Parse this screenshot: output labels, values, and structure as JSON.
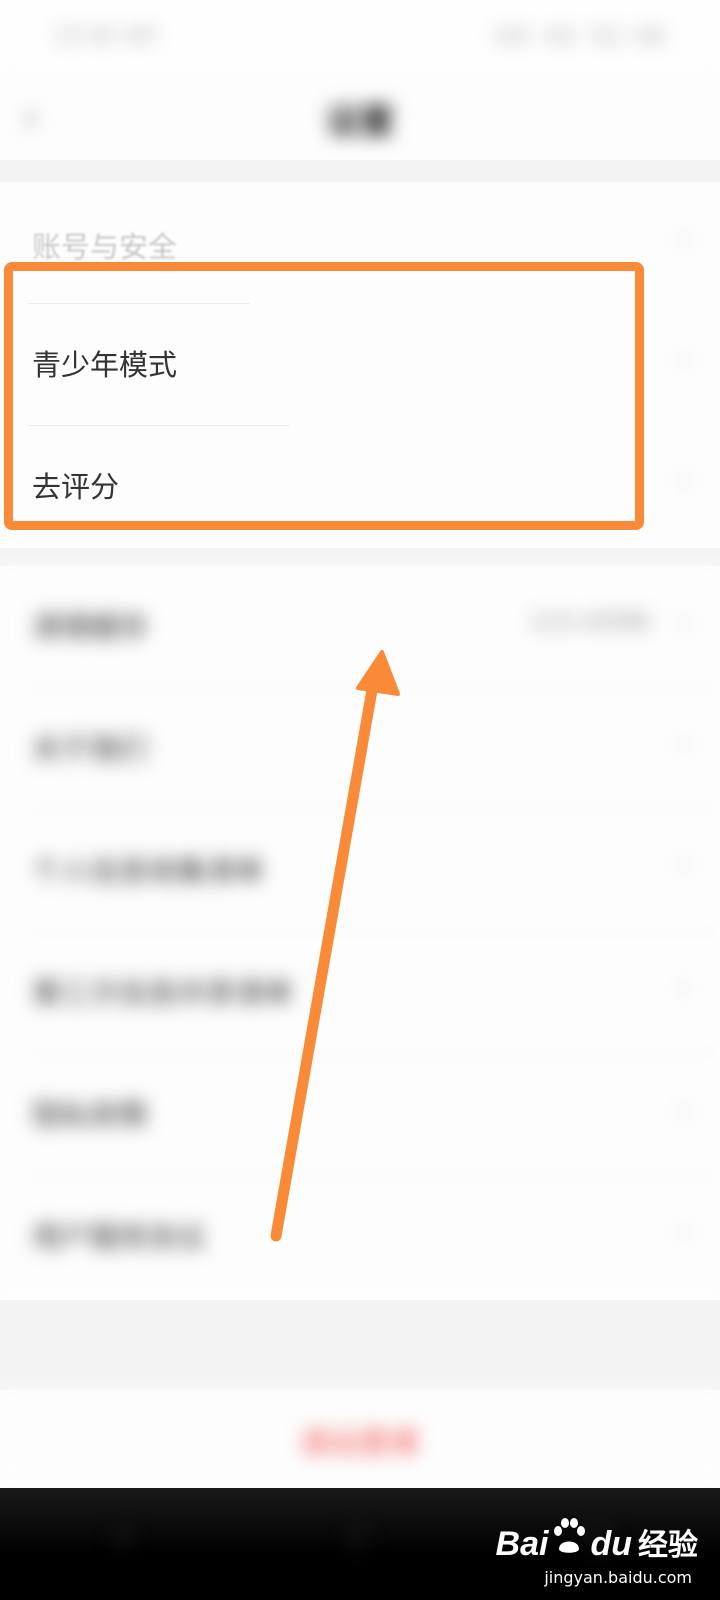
{
  "status_bar": {
    "time": "10:46 AM",
    "icons": "HD 4G 5G 86"
  },
  "nav": {
    "back_icon": "back-arrow-icon",
    "title": "设置"
  },
  "settings": {
    "rows": [
      {
        "label": "账号与安全",
        "value": ""
      },
      {
        "label": "青少年模式",
        "value": ""
      },
      {
        "label": "去评分",
        "value": ""
      },
      {
        "label": "清理缓存",
        "value": "123.45MB"
      },
      {
        "label": "关于我们",
        "value": ""
      },
      {
        "label": "个人信息收集清单",
        "value": ""
      },
      {
        "label": "第三方信息共享清单",
        "value": ""
      },
      {
        "label": "隐私政策",
        "value": ""
      },
      {
        "label": "用户服务协议",
        "value": ""
      }
    ]
  },
  "logout": {
    "label": "退出登录"
  },
  "annotation": {
    "box_color": "#f98a38",
    "arrow_color": "#f98a38"
  },
  "watermark": {
    "bai": "Bai",
    "du": "du",
    "jingyan": "经验",
    "url": "jingyan.baidu.com"
  }
}
